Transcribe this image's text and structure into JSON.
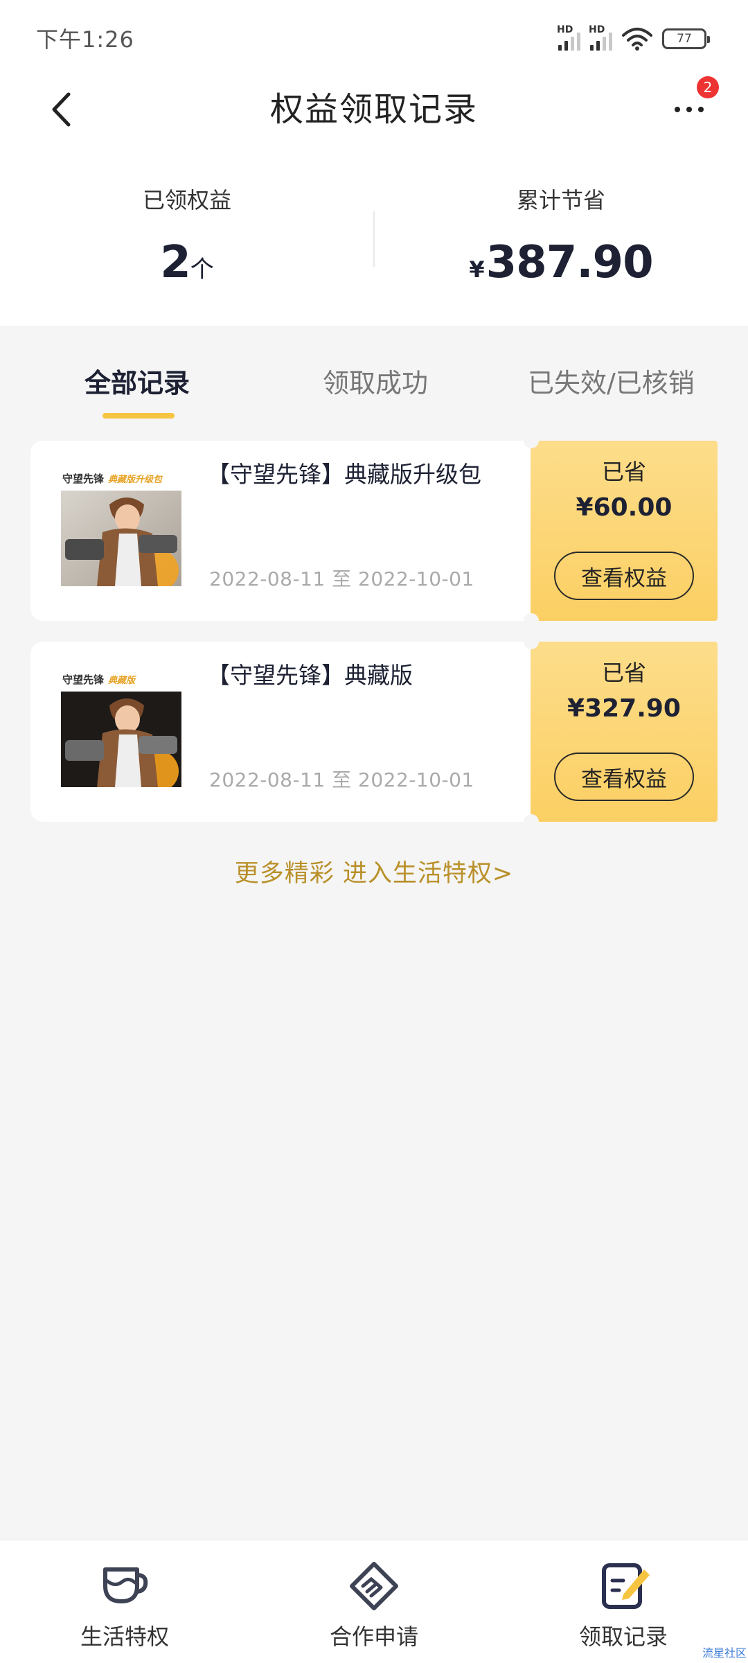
{
  "status_bar": {
    "time": "下午1:26",
    "signal_1_label": "HD",
    "signal_2_label": "HD",
    "battery": "77"
  },
  "header": {
    "title": "权益领取记录",
    "notification_count": "2"
  },
  "summary": {
    "claimed_label": "已领权益",
    "claimed_count": "2",
    "claimed_unit": "个",
    "saved_label": "累计节省",
    "saved_currency": "¥",
    "saved_total": "387.90"
  },
  "tabs": [
    {
      "label": "全部记录",
      "active": true
    },
    {
      "label": "领取成功",
      "active": false
    },
    {
      "label": "已失效/已核销",
      "active": false
    }
  ],
  "records": [
    {
      "title": "【守望先锋】典藏版升级包",
      "thumb_brand": "守望先锋",
      "thumb_tag": "典藏版升级包",
      "date_range": "2022-08-11 至 2022-10-01",
      "saved_label": "已省",
      "saved_amount": "¥60.00",
      "button_label": "查看权益"
    },
    {
      "title": "【守望先锋】典藏版",
      "thumb_brand": "守望先锋",
      "thumb_tag": "典藏版",
      "date_range": "2022-08-11 至 2022-10-01",
      "saved_label": "已省",
      "saved_amount": "¥327.90",
      "button_label": "查看权益"
    }
  ],
  "more_link": "更多精彩 进入生活特权>",
  "bottom_nav": [
    {
      "label": "生活特权",
      "icon": "cup-icon"
    },
    {
      "label": "合作申请",
      "icon": "handshake-icon"
    },
    {
      "label": "领取记录",
      "icon": "edit-note-icon"
    }
  ],
  "watermark": "流星社区",
  "colors": {
    "accent_yellow": "#f7c441",
    "card_side_top": "#fddd8b",
    "card_side_bottom": "#fbcf63",
    "link_gold": "#b9902a",
    "badge_red": "#ee3333",
    "dark_text": "#1d2133"
  }
}
